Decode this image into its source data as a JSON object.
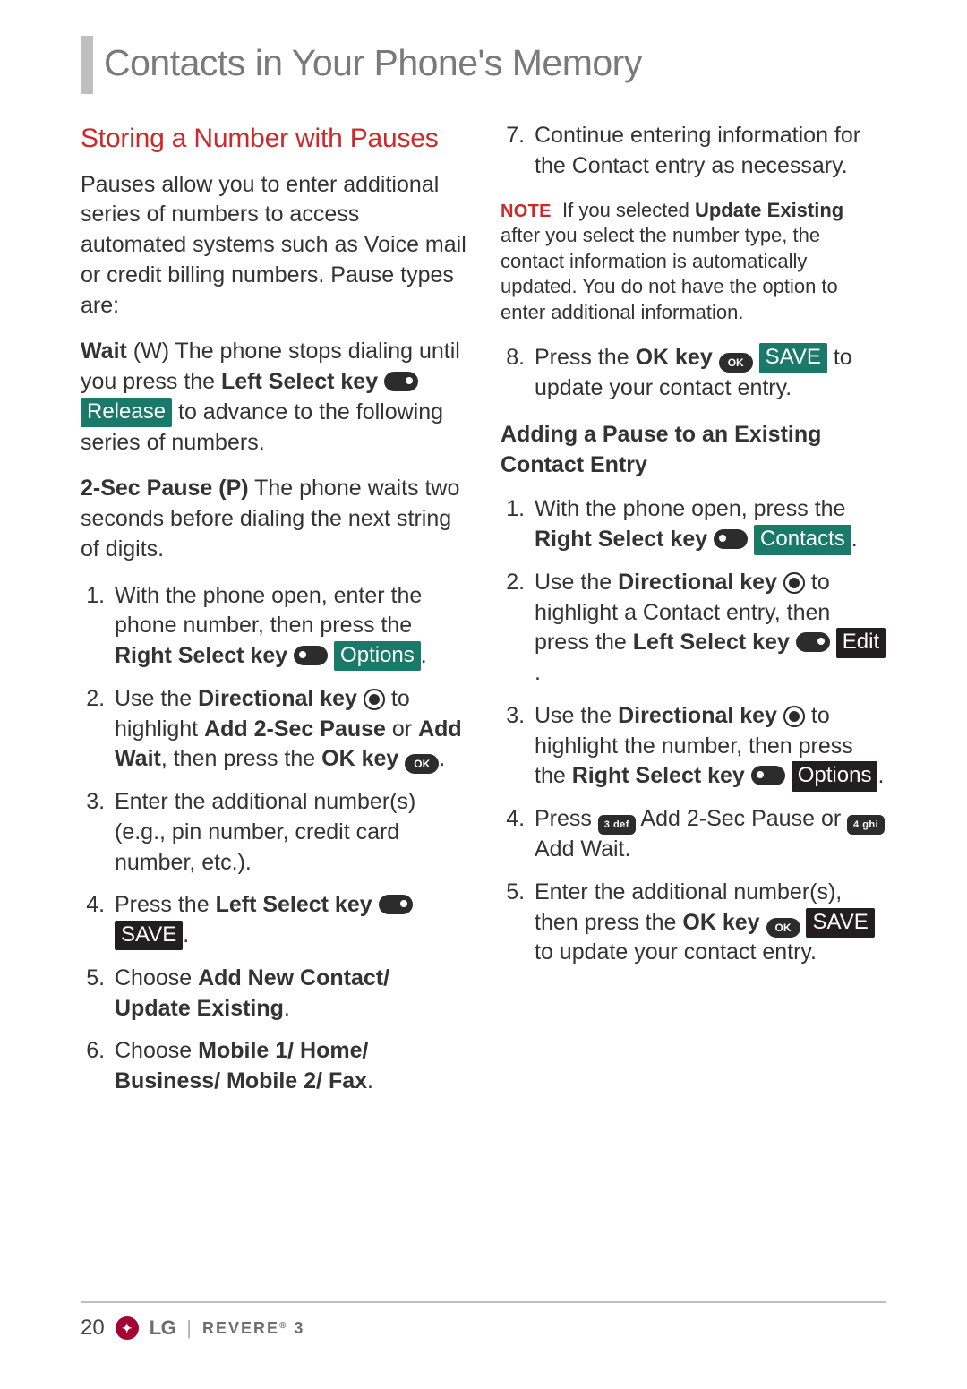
{
  "page_title": "Contacts in Your Phone's Memory",
  "page_number": "20",
  "footer": {
    "brand": "LG",
    "model": "REVERE",
    "model_suffix": "3"
  },
  "icons": {
    "ok": "OK",
    "key3": "3 def",
    "key4": "4 ghi"
  },
  "badges": {
    "release": "Release",
    "options": "Options",
    "save": "SAVE",
    "contacts": "Contacts",
    "edit": "Edit"
  },
  "left": {
    "heading": "Storing a Number with Pauses",
    "intro": "Pauses allow you to enter additional series of numbers to access automated systems such as Voice mail or credit billing numbers. Pause types are:",
    "wait_label": "Wait",
    "wait_code": " (W) ",
    "wait1": "The phone stops dialing until you press the ",
    "wait_lsk": "Left Select key",
    "wait2": " to advance to the following series of numbers.",
    "p2_label": "2-Sec Pause (P)",
    "p2_text": " The phone waits two seconds before dialing the next string of digits.",
    "s1a": "With the phone open, enter the phone number, then press the ",
    "s1b": "Right Select key",
    "s1c": ".",
    "s2a": "Use the ",
    "s2b": "Directional key",
    "s2c": " to highlight ",
    "s2d": "Add 2-Sec Pause",
    "s2e": " or ",
    "s2f": "Add Wait",
    "s2g": ", then press the ",
    "s2h": "OK key",
    "s2i": ".",
    "s3": "Enter the additional number(s) (e.g., pin number, credit card number, etc.).",
    "s4a": "Press the ",
    "s4b": "Left Select key",
    "s4c": ".",
    "s5a": "Choose ",
    "s5b": "Add New Contact/ Update Existing",
    "s5c": ".",
    "s6a": "Choose ",
    "s6b": "Mobile 1/ Home/ Business/ Mobile 2/ Fax",
    "s6c": "."
  },
  "right": {
    "s7": "Continue entering information for the Contact entry as necessary.",
    "note_label": "NOTE",
    "note_a": "If you selected ",
    "note_b": "Update Existing",
    "note_c": " after you select the number type, the contact information is automatically updated. You do not have the option to enter additional information.",
    "s8a": "Press the ",
    "s8b": "OK key",
    "s8c": " to update your contact entry.",
    "sub": "Adding a Pause to an Existing Contact Entry",
    "b1a": "With the phone open, press the ",
    "b1b": "Right Select key",
    "b1c": ".",
    "b2a": "Use the ",
    "b2b": "Directional key",
    "b2c": " to highlight a Contact entry, then press the ",
    "b2d": "Left Select key",
    "b2e": ".",
    "b3a": "Use the ",
    "b3b": "Directional key",
    "b3c": " to highlight the number, then press the ",
    "b3d": "Right Select key",
    "b3e": ".",
    "b4a": "Press ",
    "b4b": " Add 2-Sec Pause or ",
    "b4c": " Add Wait.",
    "b5a": "Enter the additional number(s), then press the ",
    "b5b": "OK key",
    "b5c": " to update your contact entry."
  }
}
